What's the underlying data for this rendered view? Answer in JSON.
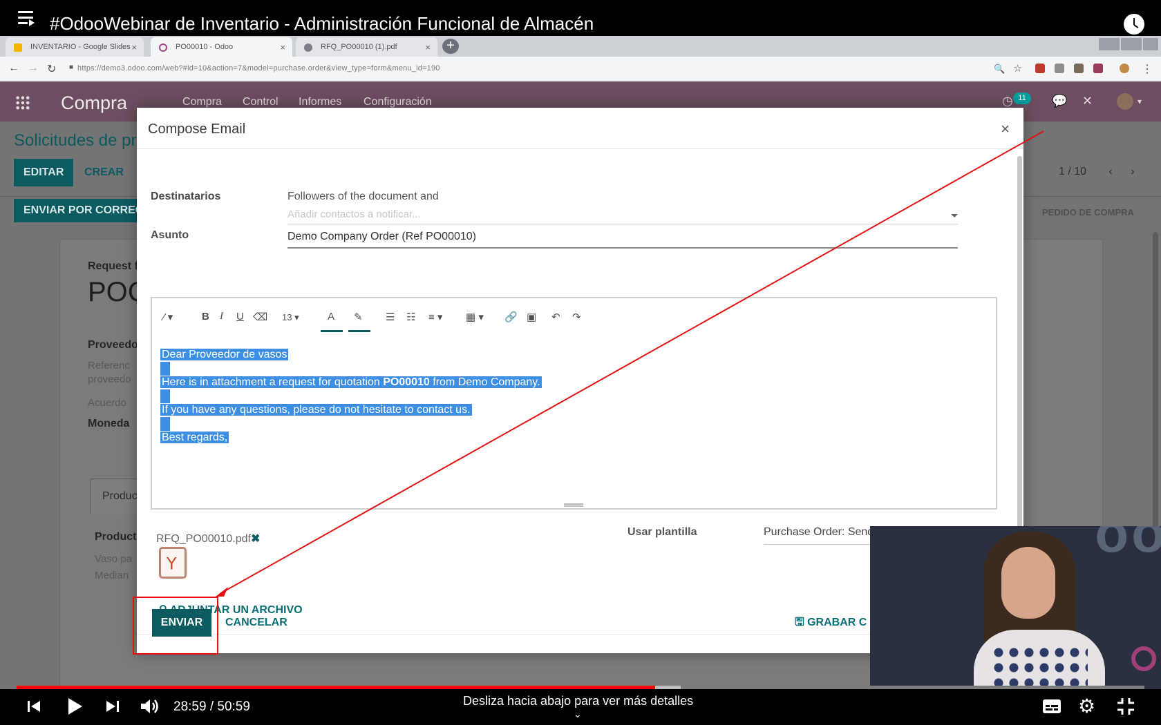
{
  "youtube": {
    "video_title": "#OdooWebinar de Inventario - Administración Funcional de Almacén",
    "time_current": "28:59",
    "time_total": "50:59",
    "time_display": "28:59 / 50:59",
    "hint": "Desliza hacia abajo para ver más detalles",
    "progress": 0.566,
    "buffered": 0.589
  },
  "browser": {
    "tabs": [
      {
        "label": "INVENTARIO - Google Slides"
      },
      {
        "label": "PO00010 - Odoo"
      },
      {
        "label": "RFQ_PO00010 (1).pdf"
      }
    ],
    "url": "https://demo3.odoo.com/web?#id=10&action=7&model=purchase.order&view_type=form&menu_id=190"
  },
  "odoo": {
    "app_name": "Compra",
    "menu": [
      "Compra",
      "Control",
      "Informes",
      "Configuración"
    ],
    "activity_count": "11",
    "breadcrumb": "Solicitudes de pr",
    "btn_edit": "EDITAR",
    "btn_create": "CREAR",
    "btn_send_email": "ENVIAR POR CORREO",
    "pager": "1 / 10",
    "status": "PEDIDO DE COMPRA",
    "sheet": {
      "request_label": "Request f",
      "record_name": "POC",
      "vendor_label": "Proveedo",
      "ref_line1": "Referenc",
      "ref_line2": "proveedo",
      "agreement": "Acuerdo",
      "currency": "Moneda",
      "tab_products": "Produc",
      "col_product": "Product",
      "row1": "Vaso pa",
      "row2": "Median"
    }
  },
  "modal": {
    "title": "Compose Email",
    "recipients_label": "Destinatarios",
    "recipients_text": "Followers of the document and",
    "recipients_placeholder": "Añadir contactos a notificar...",
    "subject_label": "Asunto",
    "subject_value": "Demo Company Order (Ref PO00010)",
    "font_size": "13",
    "body": {
      "line1": "Dear Proveedor de vasos",
      "line2_pre": "Here is in attachment a request for quotation ",
      "line2_bold": "PO00010",
      "line2_post": " from Demo Company.",
      "line3": "If you have any questions, please do not hesitate to contact us.",
      "line4": "Best regards,"
    },
    "attachment_name": "RFQ_PO00010.pdf",
    "attach_link": "ADJUNTAR UN ARCHIVO",
    "template_label": "Usar plantilla",
    "template_value": "Purchase Order: Send RFQ",
    "btn_send": "ENVIAR",
    "btn_cancel": "CANCELAR",
    "btn_save_template": "GRABAR C"
  },
  "colors": {
    "odoo_primary": "#0b5b61",
    "odoo_navbar": "#6b4e5f",
    "selection": "#3d8fe5",
    "annotation": "#e21212",
    "progress": "#ff0000"
  }
}
